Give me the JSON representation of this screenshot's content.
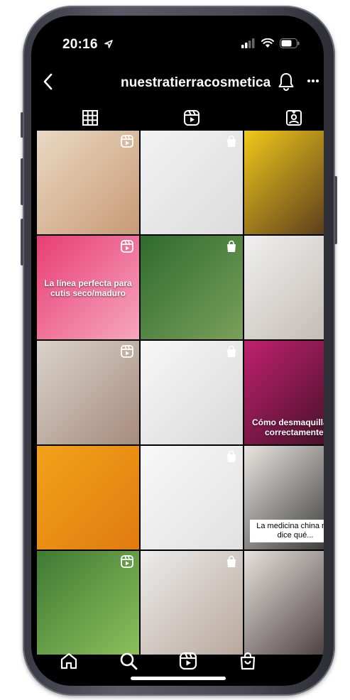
{
  "status_bar": {
    "time": "20:16"
  },
  "header": {
    "username": "nuestratierracosmetica"
  },
  "tabs": [
    {
      "icon": "grid-icon"
    },
    {
      "icon": "reels-icon"
    },
    {
      "icon": "tagged-icon"
    }
  ],
  "posts": [
    {
      "bg": "linear-gradient(135deg,#e9d9c4,#c89a75)",
      "badge": "reel",
      "text": ""
    },
    {
      "bg": "linear-gradient(135deg,#f2f2f2,#dcdcdc)",
      "badge": "shop",
      "text": ""
    },
    {
      "bg": "linear-gradient(135deg,#f1c81b,#4a2d1d)",
      "badge": "reel",
      "text": ""
    },
    {
      "bg": "linear-gradient(135deg,#e83d76,#f6a7bd)",
      "badge": "reel",
      "text": "La línea perfecta para cutis seco/maduro"
    },
    {
      "bg": "linear-gradient(135deg,#2f6b2d,#7aa05a)",
      "badge": "shop",
      "text": ""
    },
    {
      "bg": "linear-gradient(135deg,#f0f0f0,#bfb6ae)",
      "badge": "shop",
      "text": ""
    },
    {
      "bg": "linear-gradient(135deg,#d9d3cc,#a68b7b)",
      "badge": "reel",
      "text": ""
    },
    {
      "bg": "linear-gradient(135deg,#f7f7f7,#d9d9d9)",
      "badge": "shop",
      "text": ""
    },
    {
      "bg": "linear-gradient(135deg,#c02070,#3a1020)",
      "badge": "reel",
      "text": "Cómo desmaquillarte correctamente."
    },
    {
      "bg": "linear-gradient(135deg,#f2a21a,#e07b10)",
      "badge": "",
      "text": ""
    },
    {
      "bg": "linear-gradient(135deg,#f8f8f8,#e1e1e1)",
      "badge": "shop",
      "text": ""
    },
    {
      "bg": "linear-gradient(135deg,#e9e4e0,#2a2a2a)",
      "badge": "reel",
      "text": "La medicina china nos dice qué..."
    },
    {
      "bg": "linear-gradient(135deg,#3f7a34,#8cbf5b)",
      "badge": "reel",
      "text": ""
    },
    {
      "bg": "linear-gradient(135deg,#ececec,#b8a89c)",
      "badge": "shop",
      "text": ""
    },
    {
      "bg": "linear-gradient(135deg,#e6e2de,#3c3030)",
      "badge": "reel",
      "text": ""
    }
  ],
  "bottom_nav": [
    {
      "icon": "home-icon"
    },
    {
      "icon": "search-icon"
    },
    {
      "icon": "reels-icon"
    },
    {
      "icon": "shop-icon"
    }
  ]
}
